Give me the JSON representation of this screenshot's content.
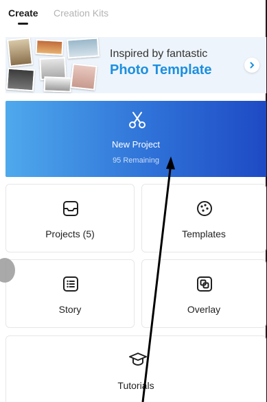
{
  "tabs": [
    {
      "label": "Create",
      "active": true
    },
    {
      "label": "Creation Kits",
      "active": false
    }
  ],
  "banner": {
    "line1": "Inspired by fantastic",
    "line2": "Photo Template"
  },
  "new_project": {
    "label": "New Project",
    "remaining": "95 Remaining"
  },
  "cards": {
    "projects": "Projects (5)",
    "templates": "Templates",
    "story": "Story",
    "overlay": "Overlay",
    "tutorials": "Tutorials"
  },
  "colors": {
    "accent": "#1b8fe0",
    "gradient_start": "#4fa9ec",
    "gradient_end": "#1e4ac4"
  }
}
